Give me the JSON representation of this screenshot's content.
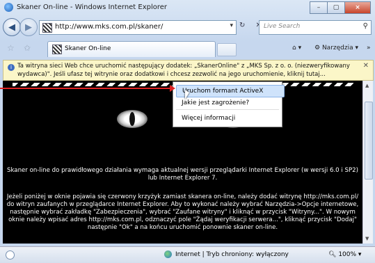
{
  "window": {
    "title": "Skaner On-line - Windows Internet Explorer",
    "controls": [
      "–",
      "▢",
      "×"
    ]
  },
  "address_bar": {
    "url": "http://www.mks.com.pl/skaner/",
    "refresh_stop": "↻ ✕"
  },
  "search": {
    "placeholder": "Live Search"
  },
  "tab": {
    "label": "Skaner On-line"
  },
  "command_bar": {
    "tools_label": "Narzędzia"
  },
  "info_bar": {
    "message": "Ta witryna sieci Web chce uruchomić następujący dodatek: „SkanerOnline\" z „MKS Sp. z o. o. (niezweryfikowany wydawca)\". Jeśli ufasz tej witrynie oraz dodatkowi i chcesz zezwolić na jego uruchomienie, kliknij tutaj..."
  },
  "context_menu": {
    "items": [
      "Uruchom formant ActiveX",
      "Jakie jest zagrożenie?",
      "Więcej informacji"
    ]
  },
  "content": {
    "paragraph1": "Skaner on-line do prawidłowego działania wymaga aktualnej wersji przeglądarki Internet Explorer (w wersji 6.0 i SP2) lub Internet Explorer 7.",
    "paragraph2": "Jeżeli poniżej w oknie pojawia się czerwony krzyżyk zamiast skanera on-line, należy dodać witrynę http://mks.com.pl/ do witryn zaufanych w przeglądarce Internet Explorer. Aby to wykonać należy wybrać Narzędzia->Opcje internetowe, następnie wybrać zakładkę \"Zabezpieczenia\", wybrać \"Zaufane witryny\" i kliknąć w przycisk \"Witryny...\". W nowym oknie należy wpisać adres http://mks.com.pl, odznaczyć pole \"Żądaj weryfikacji serwera...\", kliknąć przycisk \"Dodaj\" następnie \"Ok\" a na końcu uruchomić ponownie skaner on-line."
  },
  "status_bar": {
    "zone": "Internet | Tryb chroniony: wyłączony",
    "zoom": "100%"
  },
  "colors": {
    "infobar_bg": "#fbf6c8",
    "menu_highlight": "#cfe3fb",
    "callout_arrow": "#d22222"
  }
}
